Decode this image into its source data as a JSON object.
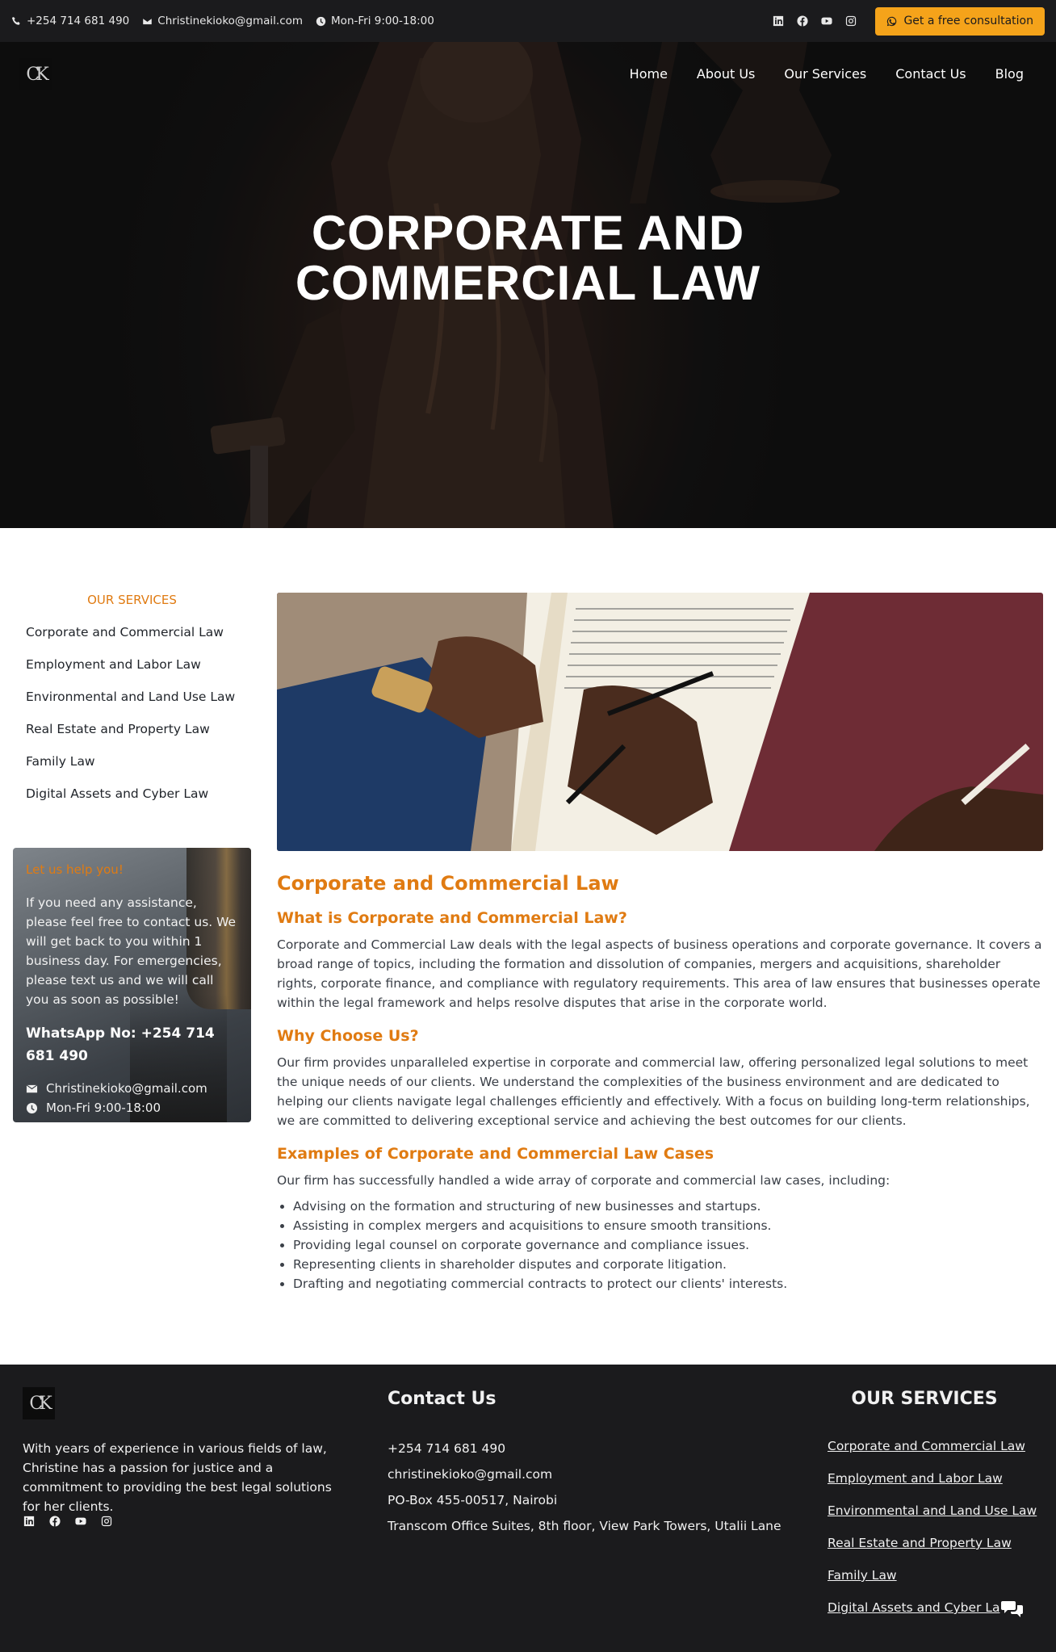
{
  "topbar": {
    "phone": "+254 714 681 490",
    "email": "Christinekioko@gmail.com",
    "hours": "Mon-Fri 9:00-18:00",
    "social_icons": [
      "linkedin-icon",
      "facebook-icon",
      "youtube-icon",
      "instagram-icon"
    ],
    "cta_label": "Get a free consultation"
  },
  "brand": {
    "logo_text": "CK"
  },
  "nav": {
    "items": [
      {
        "label": "Home"
      },
      {
        "label": "About Us"
      },
      {
        "label": "Our Services"
      },
      {
        "label": "Contact Us"
      },
      {
        "label": "Blog"
      }
    ]
  },
  "hero": {
    "title_line1": "CORPORATE AND",
    "title_line2": "COMMERCIAL LAW"
  },
  "sidebar": {
    "heading": "OUR SERVICES",
    "items": [
      {
        "label": "Corporate and Commercial Law"
      },
      {
        "label": "Employment and Labor Law"
      },
      {
        "label": "Environmental and Land Use Law"
      },
      {
        "label": "Real Estate and Property Law"
      },
      {
        "label": "Family Law"
      },
      {
        "label": "Digital Assets and Cyber Law"
      }
    ]
  },
  "help": {
    "title": "Let us help you!",
    "text": "If you need any assistance, please feel free to contact us. We will get back to you within 1 business day. For emergencies, please text us and we will call you as soon as possible!",
    "whatsapp": "WhatsApp No: +254 714 681 490",
    "email": "Christinekioko@gmail.com",
    "hours": "Mon-Fri 9:00-18:00"
  },
  "article": {
    "title": "Corporate and Commercial Law",
    "s1_heading": "What is Corporate and Commercial Law?",
    "s1_text": "Corporate and Commercial Law deals with the legal aspects of business operations and corporate governance. It covers a broad range of topics, including the formation and dissolution of companies, mergers and acquisitions, shareholder rights, corporate finance, and compliance with regulatory requirements. This area of law ensures that businesses operate within the legal framework and helps resolve disputes that arise in the corporate world.",
    "s2_heading": "Why Choose Us?",
    "s2_text": "Our firm provides unparalleled expertise in corporate and commercial law, offering personalized legal solutions to meet the unique needs of our clients. We understand the complexities of the business environment and are dedicated to helping our clients navigate legal challenges efficiently and effectively. With a focus on building long-term relationships, we are committed to delivering exceptional service and achieving the best outcomes for our clients.",
    "s3_heading": "Examples of Corporate and Commercial Law Cases",
    "s3_intro": "Our firm has successfully handled a wide array of corporate and commercial law cases, including:",
    "examples": [
      "Advising on the formation and structuring of new businesses and startups.",
      "Assisting in complex mergers and acquisitions to ensure smooth transitions.",
      "Providing legal counsel on corporate governance and compliance issues.",
      "Representing clients in shareholder disputes and corporate litigation.",
      "Drafting and negotiating commercial contracts to protect our clients' interests."
    ]
  },
  "footer": {
    "about": "With years of experience in various fields of law, Christine has a passion for justice and a commitment to providing the best legal solutions for her clients.",
    "contact_title": "Contact Us",
    "contact": [
      "+254 714 681 490",
      "christinekioko@gmail.com",
      "PO-Box 455-00517, Nairobi",
      "Transcom Office Suites, 8th floor, View Park Towers, Utalii Lane"
    ],
    "services_title": "OUR SERVICES",
    "services": [
      "Corporate and Commercial Law",
      "Employment and Labor Law",
      "Environmental and Land Use Law",
      "Real Estate and Property Law",
      "Family Law",
      "Digital Assets and Cyber La"
    ]
  },
  "colors": {
    "accent": "#e07b12",
    "cta": "#f5a31a",
    "dark": "#1b1b1d"
  }
}
